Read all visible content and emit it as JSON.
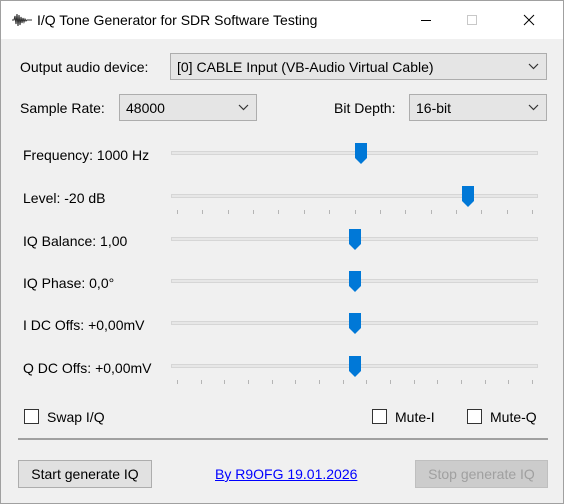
{
  "window": {
    "title": "I/Q Tone Generator for SDR Software Testing",
    "icon": "waveform-icon",
    "controls": [
      "minimize-icon",
      "maximize-icon",
      "close-icon"
    ]
  },
  "output_device": {
    "label": "Output audio device:",
    "value": "[0] CABLE Input (VB-Audio Virtual Cable)"
  },
  "sample_rate": {
    "label": "Sample Rate:",
    "value": "48000"
  },
  "bit_depth": {
    "label": "Bit Depth:",
    "value": "16-bit"
  },
  "sliders": [
    {
      "label": "Frequency: 1000 Hz",
      "position_fraction": 0.52,
      "ticks": 0
    },
    {
      "label": "Level: -20 dB",
      "position_fraction": 0.83,
      "ticks": 15
    },
    {
      "label": "IQ Balance: 1,00",
      "position_fraction": 0.5,
      "ticks": 0
    },
    {
      "label": "IQ Phase: 0,0°",
      "position_fraction": 0.5,
      "ticks": 0
    },
    {
      "label": "I DC Offs: +0,00mV",
      "position_fraction": 0.5,
      "ticks": 0
    },
    {
      "label": "Q DC Offs: +0,00mV",
      "position_fraction": 0.5,
      "ticks": 16
    }
  ],
  "checkboxes": {
    "swap": {
      "label": "Swap I/Q",
      "checked": false
    },
    "mute_i": {
      "label": "Mute-I",
      "checked": false
    },
    "mute_q": {
      "label": "Mute-Q",
      "checked": false
    }
  },
  "buttons": {
    "start": "Start generate IQ",
    "stop": "Stop generate IQ",
    "stop_enabled": false
  },
  "author_link": "By R9OFG 19.01.2026",
  "colors": {
    "accent": "#0078d7",
    "link": "#0000ff",
    "disabled_text": "#a0a0a0"
  }
}
